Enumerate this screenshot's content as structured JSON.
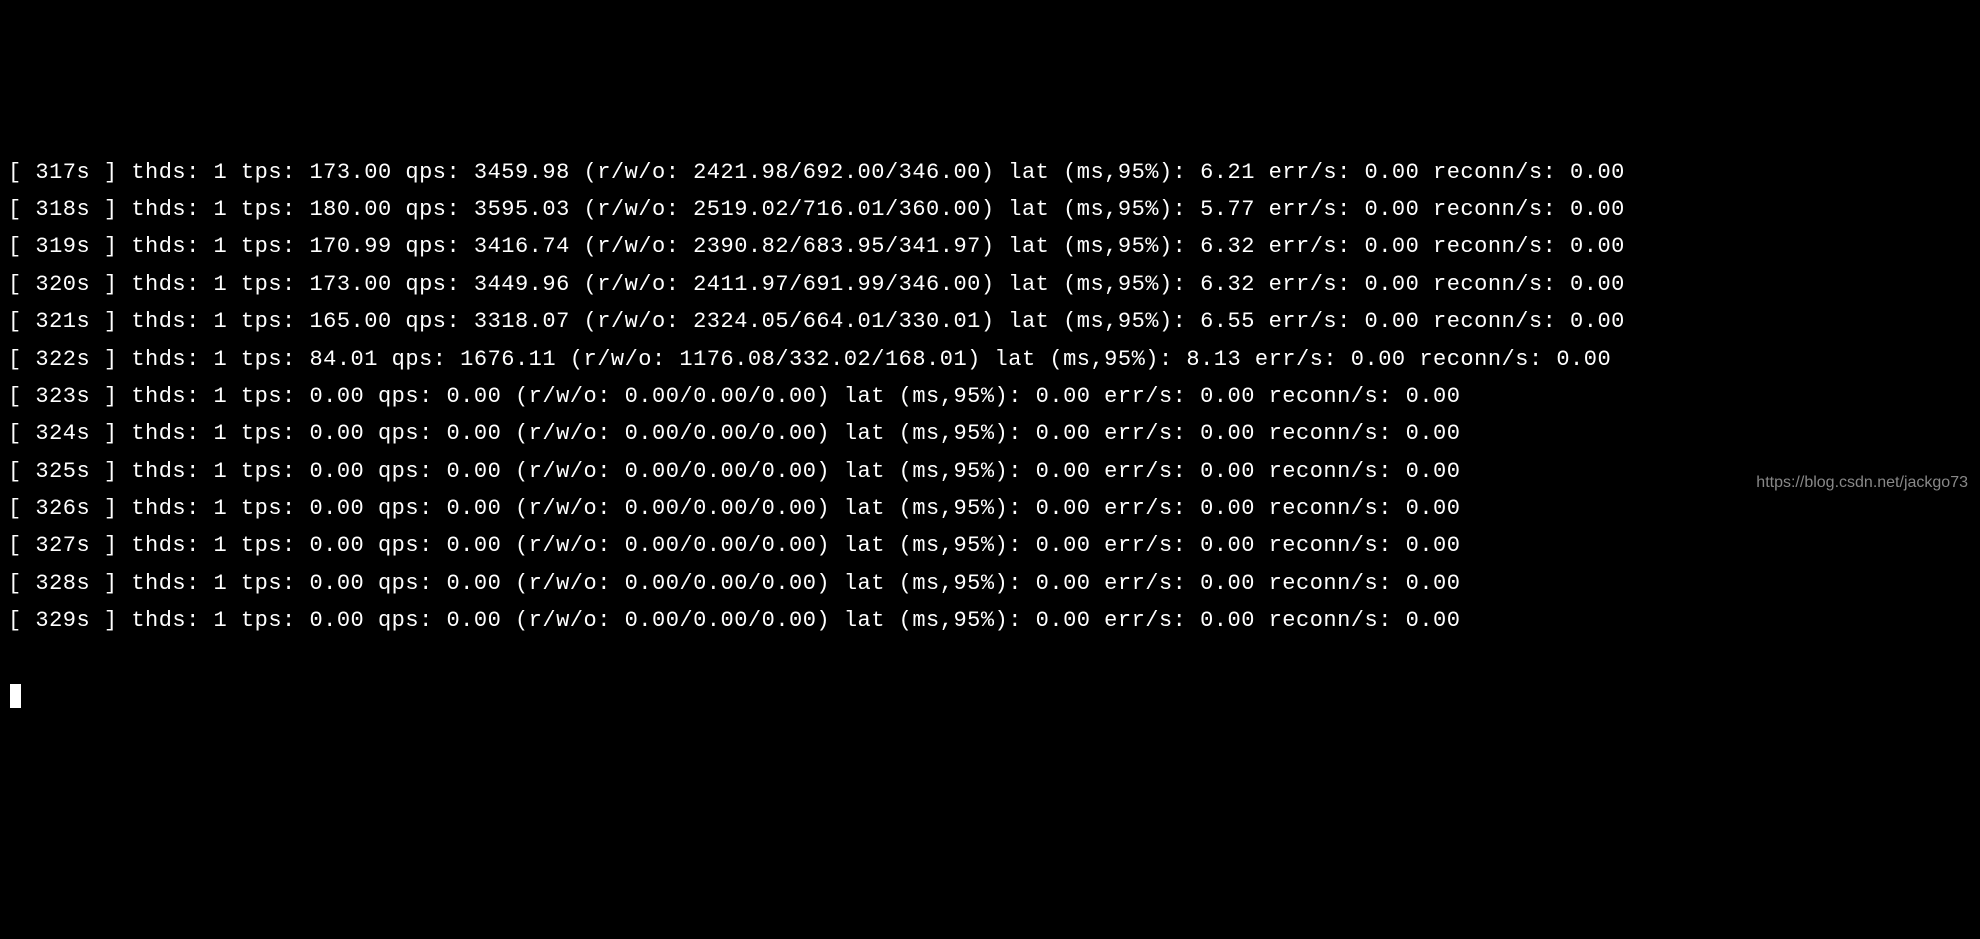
{
  "terminal": {
    "lines": [
      {
        "time": "317s",
        "thds": "1",
        "tps": "173.00",
        "qps": "3459.98",
        "rwo": "2421.98/692.00/346.00",
        "lat": "6.21",
        "err": "0.00",
        "reconn": "0.00"
      },
      {
        "time": "318s",
        "thds": "1",
        "tps": "180.00",
        "qps": "3595.03",
        "rwo": "2519.02/716.01/360.00",
        "lat": "5.77",
        "err": "0.00",
        "reconn": "0.00"
      },
      {
        "time": "319s",
        "thds": "1",
        "tps": "170.99",
        "qps": "3416.74",
        "rwo": "2390.82/683.95/341.97",
        "lat": "6.32",
        "err": "0.00",
        "reconn": "0.00"
      },
      {
        "time": "320s",
        "thds": "1",
        "tps": "173.00",
        "qps": "3449.96",
        "rwo": "2411.97/691.99/346.00",
        "lat": "6.32",
        "err": "0.00",
        "reconn": "0.00"
      },
      {
        "time": "321s",
        "thds": "1",
        "tps": "165.00",
        "qps": "3318.07",
        "rwo": "2324.05/664.01/330.01",
        "lat": "6.55",
        "err": "0.00",
        "reconn": "0.00"
      },
      {
        "time": "322s",
        "thds": "1",
        "tps": "84.01",
        "qps": "1676.11",
        "rwo": "1176.08/332.02/168.01",
        "lat": "8.13",
        "err": "0.00",
        "reconn": "0.00"
      },
      {
        "time": "323s",
        "thds": "1",
        "tps": "0.00",
        "qps": "0.00",
        "rwo": "0.00/0.00/0.00",
        "lat": "0.00",
        "err": "0.00",
        "reconn": "0.00"
      },
      {
        "time": "324s",
        "thds": "1",
        "tps": "0.00",
        "qps": "0.00",
        "rwo": "0.00/0.00/0.00",
        "lat": "0.00",
        "err": "0.00",
        "reconn": "0.00"
      },
      {
        "time": "325s",
        "thds": "1",
        "tps": "0.00",
        "qps": "0.00",
        "rwo": "0.00/0.00/0.00",
        "lat": "0.00",
        "err": "0.00",
        "reconn": "0.00"
      },
      {
        "time": "326s",
        "thds": "1",
        "tps": "0.00",
        "qps": "0.00",
        "rwo": "0.00/0.00/0.00",
        "lat": "0.00",
        "err": "0.00",
        "reconn": "0.00"
      },
      {
        "time": "327s",
        "thds": "1",
        "tps": "0.00",
        "qps": "0.00",
        "rwo": "0.00/0.00/0.00",
        "lat": "0.00",
        "err": "0.00",
        "reconn": "0.00"
      },
      {
        "time": "328s",
        "thds": "1",
        "tps": "0.00",
        "qps": "0.00",
        "rwo": "0.00/0.00/0.00",
        "lat": "0.00",
        "err": "0.00",
        "reconn": "0.00"
      },
      {
        "time": "329s",
        "thds": "1",
        "tps": "0.00",
        "qps": "0.00",
        "rwo": "0.00/0.00/0.00",
        "lat": "0.00",
        "err": "0.00",
        "reconn": "0.00"
      }
    ]
  },
  "watermark": "https://blog.csdn.net/jackgo73"
}
